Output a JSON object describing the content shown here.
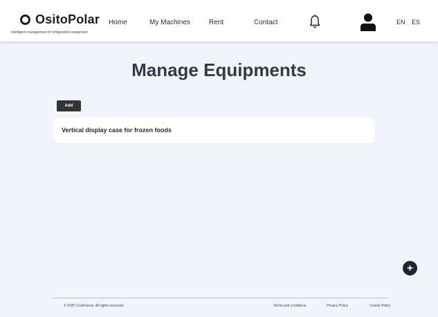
{
  "header": {
    "brand": "OsitoPolar",
    "tagline": "Intelligent management of refrigeration equipment",
    "nav": [
      "Home",
      "My Machines",
      "Rent",
      "Contact"
    ],
    "lang_en": "EN",
    "lang_es": "ES"
  },
  "main": {
    "title": "Manage Equipments",
    "add_label": "Add",
    "items": [
      {
        "name": "Vertical display case for frozen foods"
      }
    ],
    "fab_label": "+"
  },
  "footer": {
    "copyright": "© 2025 CoolFreeze. All rights reserved.",
    "links": [
      "Terms and conditions",
      "Privacy Policy",
      "Cookie Policy"
    ]
  }
}
